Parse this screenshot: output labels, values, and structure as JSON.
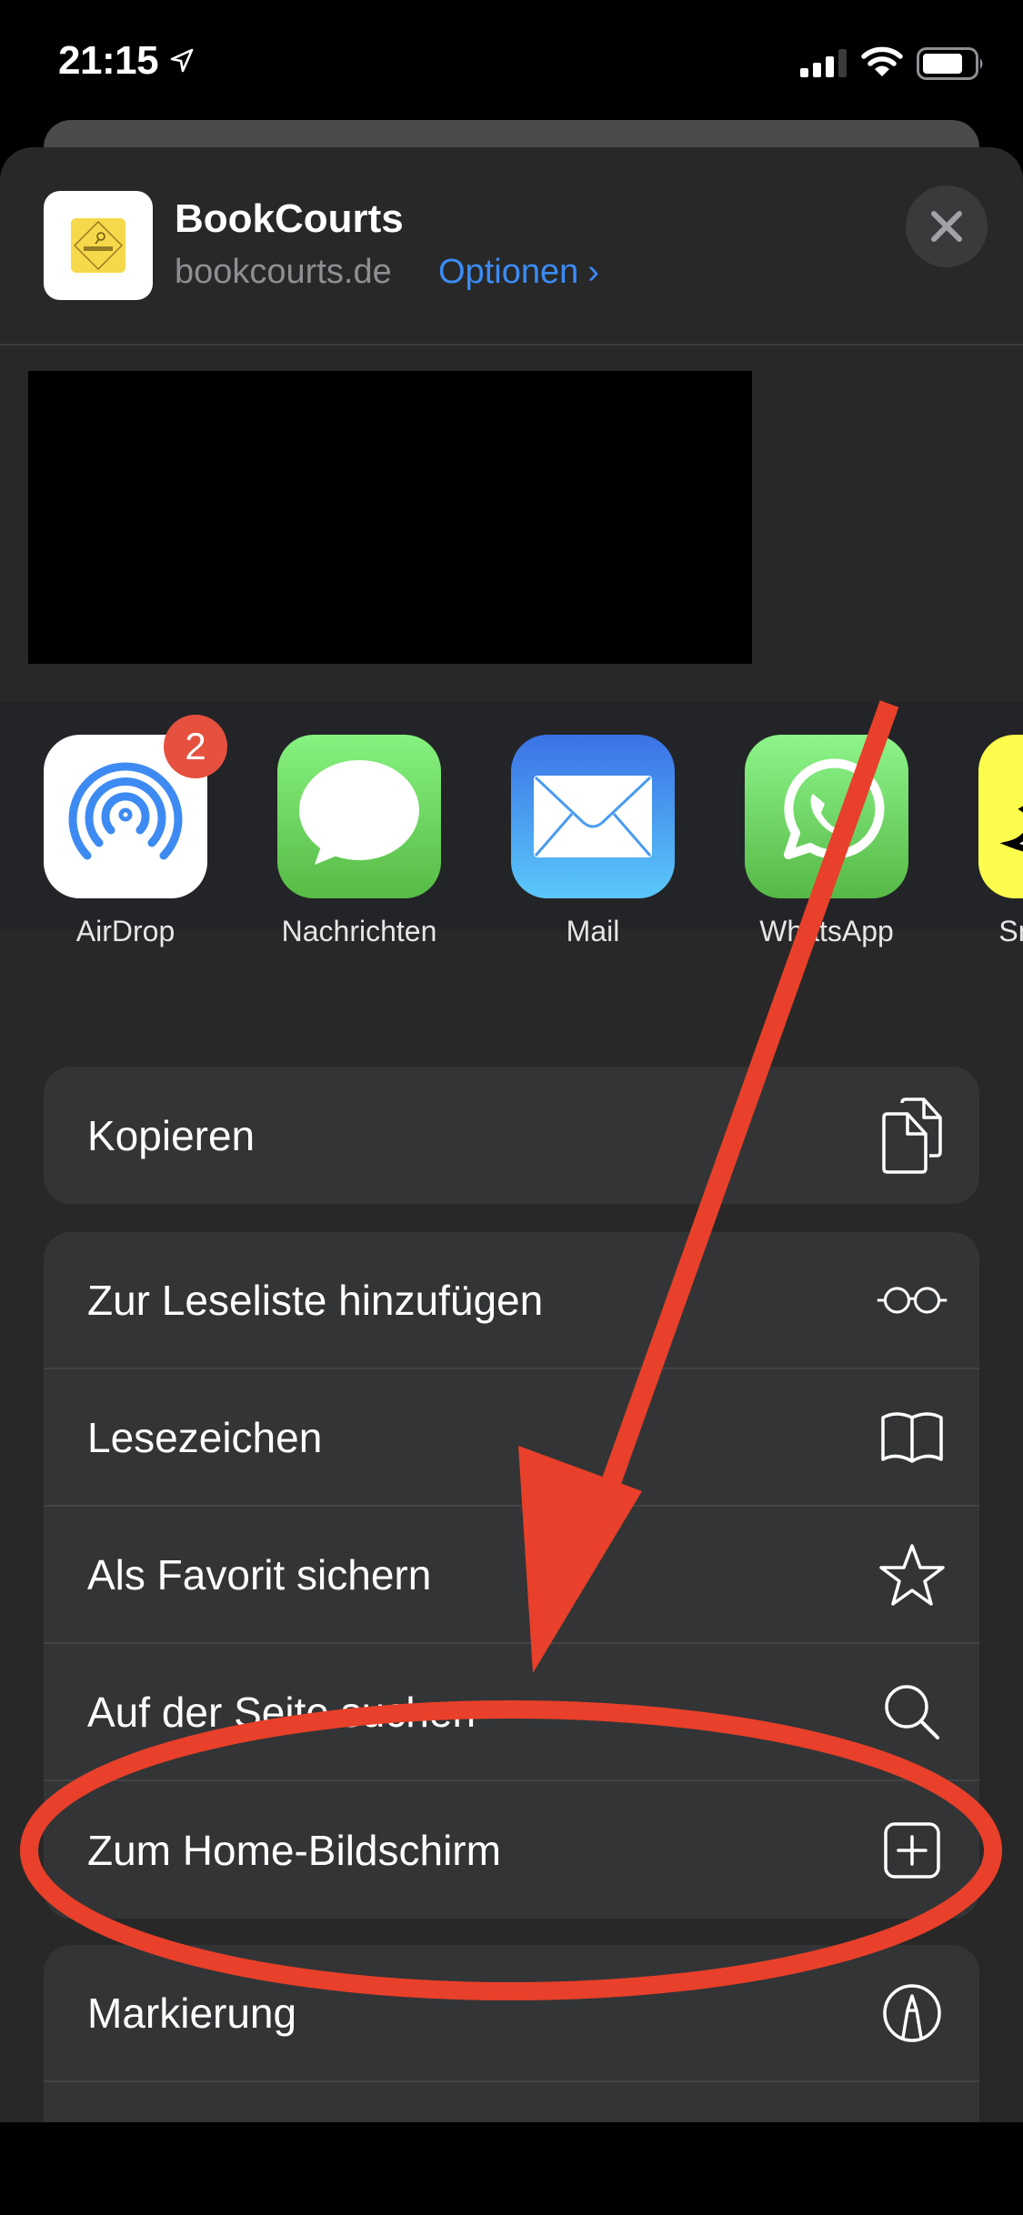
{
  "status_bar": {
    "time": "21:15",
    "location_icon": "location-arrow-icon",
    "signal_icon": "cellular-signal-icon",
    "wifi_icon": "wifi-icon",
    "battery_icon": "battery-icon"
  },
  "header": {
    "site_name": "BookCourts",
    "site_url": "bookcourts.de",
    "options_label": "Optionen",
    "options_chevron": "›",
    "close_icon": "close-icon"
  },
  "apps": [
    {
      "label": "AirDrop",
      "icon": "airdrop-icon",
      "badge": "2"
    },
    {
      "label": "Nachrichten",
      "icon": "messages-icon"
    },
    {
      "label": "Mail",
      "icon": "mail-icon"
    },
    {
      "label": "WhatsApp",
      "icon": "whatsapp-icon"
    },
    {
      "label": "Snapchat",
      "icon": "snapchat-icon"
    }
  ],
  "actions": {
    "group1": [
      {
        "label": "Kopieren",
        "icon": "copy-icon"
      }
    ],
    "group2": [
      {
        "label": "Zur Leseliste hinzufügen",
        "icon": "glasses-icon"
      },
      {
        "label": "Lesezeichen",
        "icon": "book-icon"
      },
      {
        "label": "Als Favorit sichern",
        "icon": "star-icon"
      },
      {
        "label": "Auf der Seite suchen",
        "icon": "search-icon"
      },
      {
        "label": "Zum Home-Bildschirm",
        "icon": "add-square-icon"
      }
    ],
    "group3": [
      {
        "label": "Markierung",
        "icon": "markup-icon"
      },
      {
        "label": "",
        "icon": "print-icon"
      }
    ]
  },
  "annotation": {
    "color": "#e8402a",
    "target": "Zum Home-Bildschirm"
  }
}
